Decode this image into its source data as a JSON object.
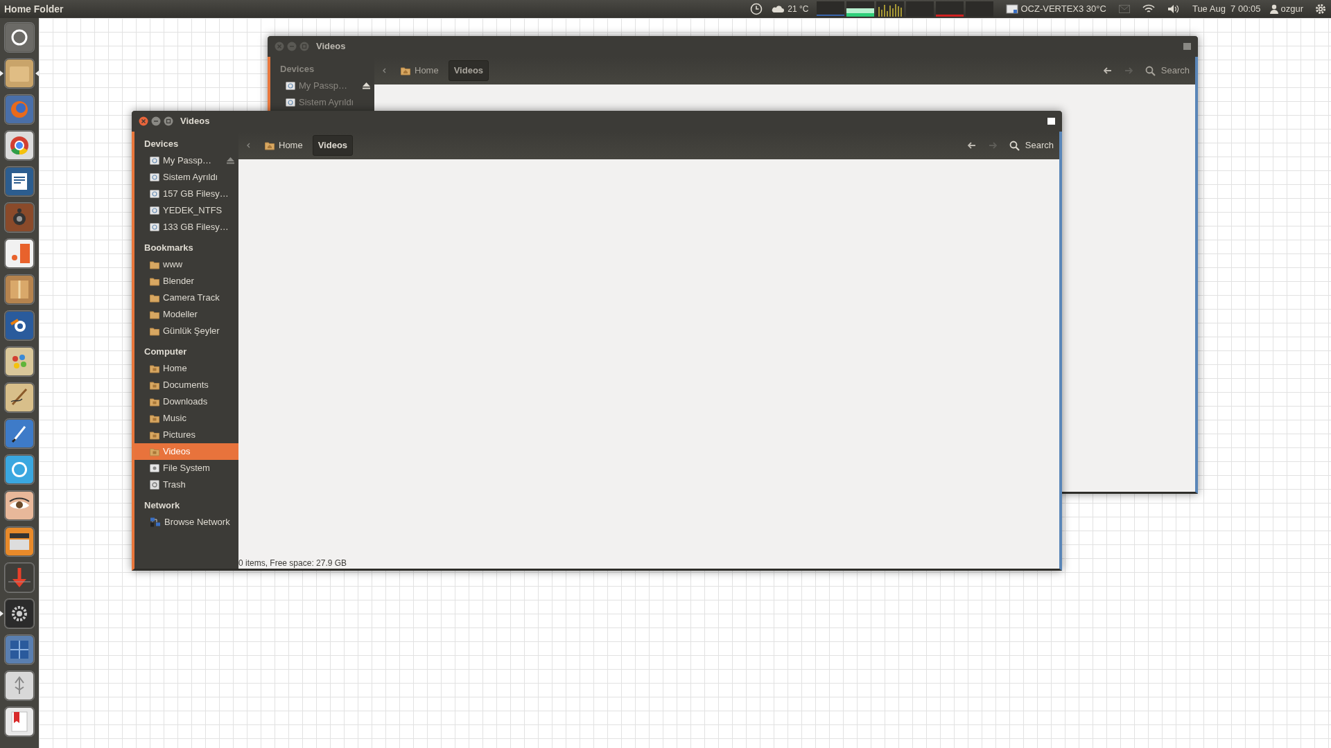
{
  "panel": {
    "title": "Home Folder",
    "weather": "21 °C",
    "drive": "OCZ-VERTEX3 30°C",
    "clock": "Tue Aug  7 00:05",
    "user": "ozgur"
  },
  "launcher": [
    {
      "running": false,
      "focused": false
    },
    {
      "running": true,
      "focused": true
    },
    {
      "running": false,
      "focused": false
    },
    {
      "running": false,
      "focused": false
    },
    {
      "running": false,
      "focused": false
    },
    {
      "running": false,
      "focused": false
    },
    {
      "running": false,
      "focused": false
    },
    {
      "running": false,
      "focused": false
    },
    {
      "running": false,
      "focused": false
    },
    {
      "running": false,
      "focused": false
    },
    {
      "running": false,
      "focused": false
    },
    {
      "running": false,
      "focused": false
    },
    {
      "running": false,
      "focused": false
    },
    {
      "running": false,
      "focused": false
    },
    {
      "running": false,
      "focused": false
    },
    {
      "running": false,
      "focused": false
    },
    {
      "running": true,
      "focused": false
    },
    {
      "running": false,
      "focused": false
    },
    {
      "running": false,
      "focused": false
    },
    {
      "running": false,
      "focused": false
    }
  ],
  "windows": [
    {
      "focused": false,
      "title": "Videos",
      "back_enabled": true,
      "forward_enabled": false,
      "search": "Search",
      "path": [
        {
          "label": "Home",
          "kind": "home",
          "selected": false
        },
        {
          "label": "Videos",
          "kind": "plain",
          "selected": true
        }
      ],
      "sidebar": [
        {
          "heading": "Devices",
          "items": [
            {
              "label": "My Passp…",
              "kind": "drive",
              "eject": true,
              "selected": false
            },
            {
              "label": "Sistem Ayrıldı",
              "kind": "drive",
              "eject": false,
              "selected": false
            }
          ]
        }
      ]
    },
    {
      "focused": true,
      "title": "Videos",
      "back_enabled": true,
      "forward_enabled": false,
      "search": "Search",
      "path": [
        {
          "label": "Home",
          "kind": "home",
          "selected": false
        },
        {
          "label": "Videos",
          "kind": "plain",
          "selected": true
        }
      ],
      "sidebar": [
        {
          "heading": "Devices",
          "items": [
            {
              "label": "My Passp…",
              "kind": "drive",
              "eject": true,
              "selected": false
            },
            {
              "label": "Sistem Ayrıldı",
              "kind": "drive",
              "eject": false,
              "selected": false
            },
            {
              "label": "157 GB Filesy…",
              "kind": "drive",
              "eject": false,
              "selected": false
            },
            {
              "label": "YEDEK_NTFS",
              "kind": "drive",
              "eject": false,
              "selected": false
            },
            {
              "label": "133 GB Filesy…",
              "kind": "drive",
              "eject": false,
              "selected": false
            }
          ]
        },
        {
          "heading": "Bookmarks",
          "items": [
            {
              "label": "www",
              "kind": "folder",
              "eject": false,
              "selected": false
            },
            {
              "label": "Blender",
              "kind": "folder",
              "eject": false,
              "selected": false
            },
            {
              "label": "Camera Track",
              "kind": "folder",
              "eject": false,
              "selected": false
            },
            {
              "label": "Modeller",
              "kind": "folder",
              "eject": false,
              "selected": false
            },
            {
              "label": "Günlük Şeyler",
              "kind": "folder",
              "eject": false,
              "selected": false
            }
          ]
        },
        {
          "heading": "Computer",
          "items": [
            {
              "label": "Home",
              "kind": "place",
              "eject": false,
              "selected": false
            },
            {
              "label": "Documents",
              "kind": "place",
              "eject": false,
              "selected": false
            },
            {
              "label": "Downloads",
              "kind": "place",
              "eject": false,
              "selected": false
            },
            {
              "label": "Music",
              "kind": "place",
              "eject": false,
              "selected": false
            },
            {
              "label": "Pictures",
              "kind": "place",
              "eject": false,
              "selected": false
            },
            {
              "label": "Videos",
              "kind": "place",
              "eject": false,
              "selected": true
            },
            {
              "label": "File System",
              "kind": "system",
              "eject": false,
              "selected": false
            },
            {
              "label": "Trash",
              "kind": "trash",
              "eject": false,
              "selected": false
            }
          ]
        },
        {
          "heading": "Network",
          "items": [
            {
              "label": "Browse Network",
              "kind": "network",
              "eject": false,
              "selected": false
            }
          ]
        }
      ],
      "status": "0 items, Free space: 27.9 GB"
    }
  ]
}
